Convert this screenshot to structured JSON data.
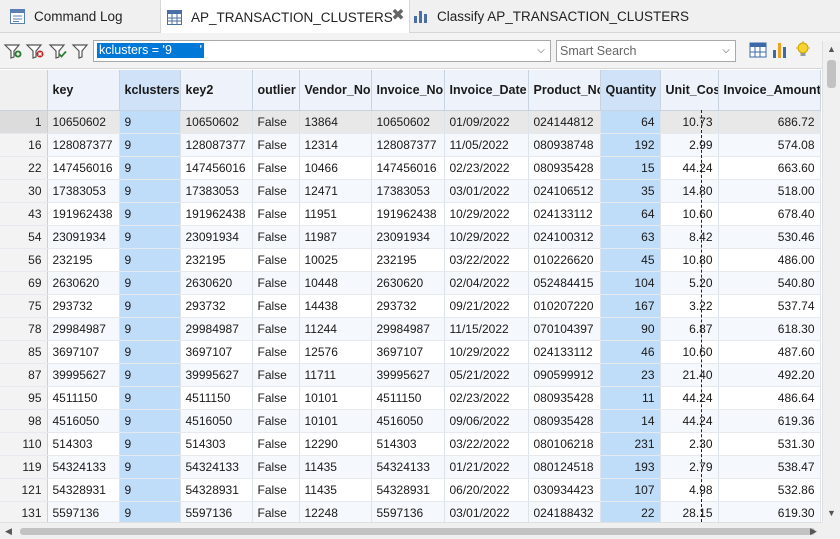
{
  "tabs": [
    {
      "label": "Command Log",
      "icon": "command-log-icon"
    },
    {
      "label": "AP_TRANSACTION_CLUSTERS",
      "icon": "table-icon",
      "active": true
    },
    {
      "label": "Classify AP_TRANSACTION_CLUSTERS",
      "icon": "chart-icon"
    }
  ],
  "tab_close": "✖",
  "toolbar": {
    "filter_expression": "kclusters = '9        '",
    "search_placeholder": "Smart Search"
  },
  "columns": [
    "key",
    "kclusters",
    "key2",
    "outlier",
    "Vendor_No",
    "Invoice_No",
    "Invoice_Date",
    "Product_No",
    "Quantity",
    "Unit_Cost",
    "Invoice_Amount"
  ],
  "rows": [
    [
      "1",
      "10650602",
      "9",
      "10650602",
      "False",
      "13864",
      "10650602",
      "01/09/2022",
      "024144812",
      "64",
      "10.73",
      "686.72"
    ],
    [
      "16",
      "128087377",
      "9",
      "128087377",
      "False",
      "12314",
      "128087377",
      "11/05/2022",
      "080938748",
      "192",
      "2.99",
      "574.08"
    ],
    [
      "22",
      "147456016",
      "9",
      "147456016",
      "False",
      "10466",
      "147456016",
      "02/23/2022",
      "080935428",
      "15",
      "44.24",
      "663.60"
    ],
    [
      "30",
      "17383053",
      "9",
      "17383053",
      "False",
      "12471",
      "17383053",
      "03/01/2022",
      "024106512",
      "35",
      "14.80",
      "518.00"
    ],
    [
      "43",
      "191962438",
      "9",
      "191962438",
      "False",
      "11951",
      "191962438",
      "10/29/2022",
      "024133112",
      "64",
      "10.60",
      "678.40"
    ],
    [
      "54",
      "23091934",
      "9",
      "23091934",
      "False",
      "11987",
      "23091934",
      "10/29/2022",
      "024100312",
      "63",
      "8.42",
      "530.46"
    ],
    [
      "56",
      "232195",
      "9",
      "232195",
      "False",
      "10025",
      "232195",
      "03/22/2022",
      "010226620",
      "45",
      "10.80",
      "486.00"
    ],
    [
      "69",
      "2630620",
      "9",
      "2630620",
      "False",
      "10448",
      "2630620",
      "02/04/2022",
      "052484415",
      "104",
      "5.20",
      "540.80"
    ],
    [
      "75",
      "293732",
      "9",
      "293732",
      "False",
      "14438",
      "293732",
      "09/21/2022",
      "010207220",
      "167",
      "3.22",
      "537.74"
    ],
    [
      "78",
      "29984987",
      "9",
      "29984987",
      "False",
      "11244",
      "29984987",
      "11/15/2022",
      "070104397",
      "90",
      "6.87",
      "618.30"
    ],
    [
      "85",
      "3697107",
      "9",
      "3697107",
      "False",
      "12576",
      "3697107",
      "10/29/2022",
      "024133112",
      "46",
      "10.60",
      "487.60"
    ],
    [
      "87",
      "39995627",
      "9",
      "39995627",
      "False",
      "11711",
      "39995627",
      "05/21/2022",
      "090599912",
      "23",
      "21.40",
      "492.20"
    ],
    [
      "95",
      "4511150",
      "9",
      "4511150",
      "False",
      "10101",
      "4511150",
      "02/23/2022",
      "080935428",
      "11",
      "44.24",
      "486.64"
    ],
    [
      "98",
      "4516050",
      "9",
      "4516050",
      "False",
      "10101",
      "4516050",
      "09/06/2022",
      "080935428",
      "14",
      "44.24",
      "619.36"
    ],
    [
      "110",
      "514303",
      "9",
      "514303",
      "False",
      "12290",
      "514303",
      "03/22/2022",
      "080106218",
      "231",
      "2.30",
      "531.30"
    ],
    [
      "119",
      "54324133",
      "9",
      "54324133",
      "False",
      "11435",
      "54324133",
      "01/21/2022",
      "080124518",
      "193",
      "2.79",
      "538.47"
    ],
    [
      "121",
      "54328931",
      "9",
      "54328931",
      "False",
      "11435",
      "54328931",
      "06/20/2022",
      "030934423",
      "107",
      "4.98",
      "532.86"
    ],
    [
      "131",
      "5597136",
      "9",
      "5597136",
      "False",
      "12248",
      "5597136",
      "03/01/2022",
      "024188432",
      "22",
      "28.15",
      "619.30"
    ]
  ],
  "colors": {
    "selected_column": "#bfdcf8",
    "filter_highlight": "#0078d7"
  }
}
